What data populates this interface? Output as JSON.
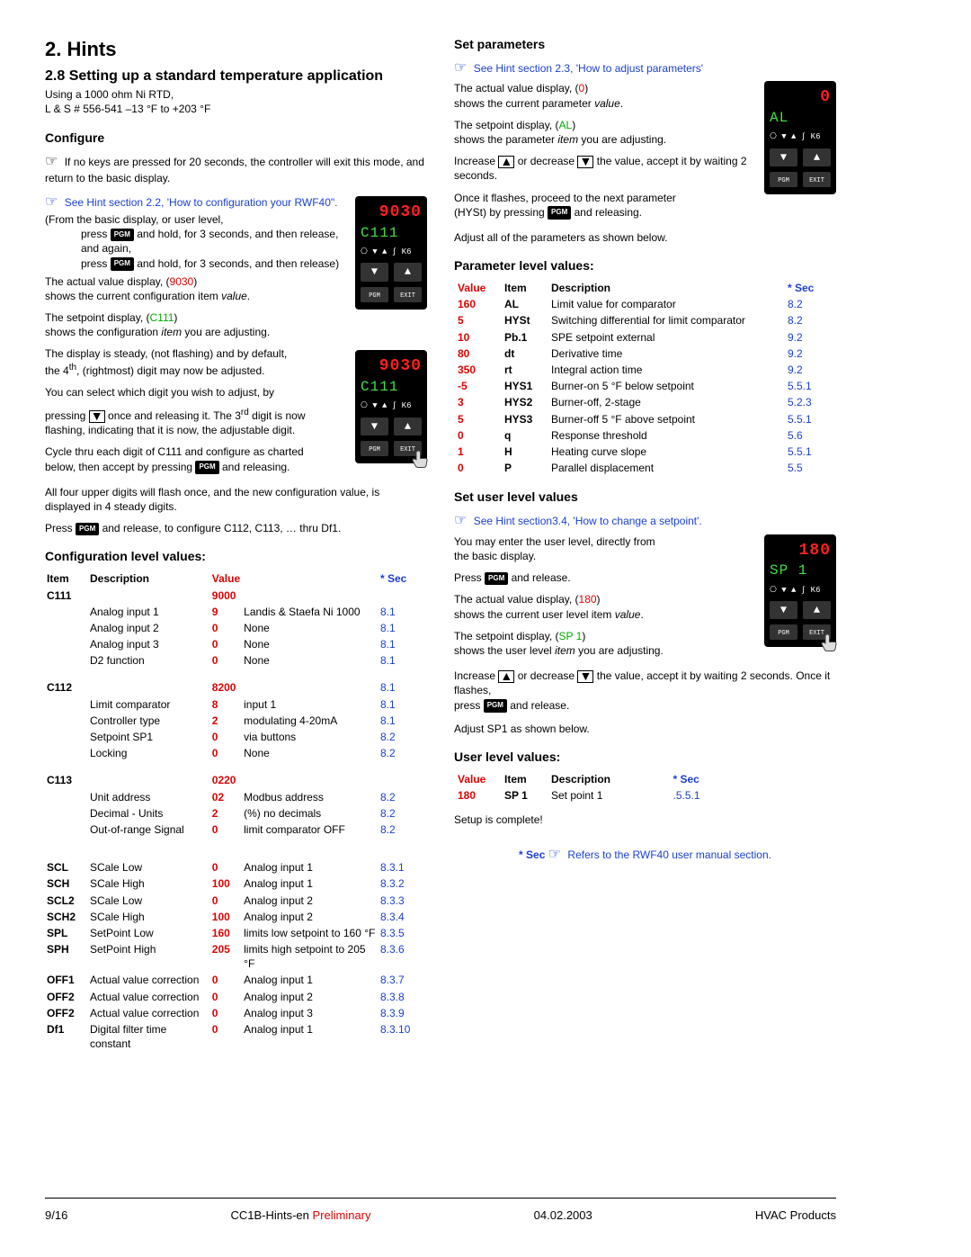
{
  "left": {
    "h1": "2. Hints",
    "h2": "2.8 Setting up a standard temperature application",
    "intro1": "Using a 1000 ohm Ni RTD,",
    "intro2": "L & S # 556-541 –13 °F to +203 °F",
    "configure": "Configure",
    "cfg_p1_a": "If no keys are pressed for 20 seconds, the controller will exit this mode, and return to the basic display.",
    "cfg_link": "See Hint section 2.2, 'How to configuration your RWF40\".",
    "cfg_p2": "(From the basic display, or user level,",
    "cfg_p3a": "press ",
    "cfg_p3b": " and hold, for 3 seconds, and then release, and again,",
    "cfg_p4a": "press ",
    "cfg_p4b": " and hold, for 3 seconds, and then release)",
    "cfg_p5a": "The actual value display, (",
    "cfg_p5_val": "9030",
    "cfg_p5b": ")",
    "cfg_p5c": "shows the current configuration item ",
    "cfg_p5d": "value",
    "cfg_p6a": "The setpoint display, (",
    "cfg_p6_val": "C111",
    "cfg_p6b": ")",
    "cfg_p6c": "shows the configuration ",
    "cfg_p6d": "item",
    "cfg_p6e": " you are adjusting.",
    "cfg_p7a": "The display is steady, (not flashing) and by default,",
    "cfg_p7b": "the 4",
    "cfg_p7c": ", (rightmost) digit may now be adjusted.",
    "cfg_p8": "You can select which digit you wish to adjust, by",
    "cfg_p9a": "pressing ",
    "cfg_p9b": " once and releasing it. The 3",
    "cfg_p9c": " digit is now flashing, indicating that it is now, the adjustable digit.",
    "cfg_p10a": "Cycle thru each digit of C111 and configure as charted",
    "cfg_p10b": "below, then accept by pressing ",
    "cfg_p10c": " and releasing.",
    "cfg_p11": "All four upper digits will flash once, and the new configuration value, is displayed in 4 steady digits.",
    "cfg_p12a": "Press ",
    "cfg_p12b": " and release, to configure C112, C113, … thru Df1.",
    "cfg_h3": "Configuration level values:",
    "config_head": {
      "item": "Item",
      "desc": "Description",
      "value": "Value",
      "sec": "* Sec"
    },
    "config_groups": [
      {
        "item": "C111",
        "group": "9000",
        "sec": "",
        "rows": [
          {
            "desc": "Analog input 1",
            "v": "9",
            "extra": "Landis & Staefa Ni 1000",
            "sec": "8.1"
          },
          {
            "desc": "Analog input 2",
            "v": "0",
            "extra": "None",
            "sec": "8.1"
          },
          {
            "desc": "Analog input 3",
            "v": "0",
            "extra": "None",
            "sec": "8.1"
          },
          {
            "desc": "D2 function",
            "v": "0",
            "extra": "None",
            "sec": "8.1"
          }
        ]
      },
      {
        "item": "C112",
        "group": "8200",
        "sec": "8.1",
        "rows": [
          {
            "desc": "Limit comparator",
            "v": "8",
            "extra": "input 1",
            "sec": "8.1"
          },
          {
            "desc": "Controller type",
            "v": "2",
            "extra": "modulating 4-20mA",
            "sec": "8.1"
          },
          {
            "desc": "Setpoint SP1",
            "v": "0",
            "extra": "via buttons",
            "sec": "8.2"
          },
          {
            "desc": "Locking",
            "v": "0",
            "extra": "None",
            "sec": "8.2"
          }
        ]
      },
      {
        "item": "C113",
        "group": "0220",
        "sec": "",
        "rows": [
          {
            "desc": "Unit address",
            "v": "02",
            "extra": "Modbus address",
            "sec": "8.2"
          },
          {
            "desc": "Decimal - Units",
            "v": "2",
            "extra": "(%) no decimals",
            "sec": "8.2"
          },
          {
            "desc": "Out-of-range Signal",
            "v": "0",
            "extra": "limit comparator OFF",
            "sec": "8.2"
          }
        ]
      }
    ],
    "config_singles": [
      {
        "item": "SCL",
        "desc": "SCale Low",
        "v": "0",
        "extra": "Analog input 1",
        "sec": "8.3.1"
      },
      {
        "item": "SCH",
        "desc": "SCale High",
        "v": "100",
        "extra": "Analog input 1",
        "sec": "8.3.2"
      },
      {
        "item": "SCL2",
        "desc": "SCale Low",
        "v": "0",
        "extra": "Analog input 2",
        "sec": "8.3.3"
      },
      {
        "item": "SCH2",
        "desc": "SCale High",
        "v": "100",
        "extra": "Analog input 2",
        "sec": "8.3.4"
      },
      {
        "item": "SPL",
        "desc": "SetPoint Low",
        "v": "160",
        "extra": "limits low setpoint to 160 °F",
        "sec": "8.3.5"
      },
      {
        "item": "SPH",
        "desc": "SetPoint High",
        "v": "205",
        "extra": "limits high setpoint to 205 °F",
        "sec": "8.3.6"
      },
      {
        "item": "OFF1",
        "desc": "Actual value correction",
        "v": "0",
        "extra": "Analog input 1",
        "sec": "8.3.7"
      },
      {
        "item": "OFF2",
        "desc": "Actual value correction",
        "v": "0",
        "extra": "Analog input 2",
        "sec": "8.3.8"
      },
      {
        "item": "OFF2",
        "desc": "Actual value correction",
        "v": "0",
        "extra": "Analog input 3",
        "sec": "8.3.9"
      },
      {
        "item": "Df1",
        "desc": "Digital filter time constant",
        "v": "0",
        "extra": "Analog input 1",
        "sec": "8.3.10"
      }
    ]
  },
  "right": {
    "sp_h3": "Set parameters",
    "sp_link": "See Hint section 2.3, 'How to adjust parameters'",
    "sp_p1a": "The actual value display, (",
    "sp_p1v": "0",
    "sp_p1b": ")",
    "sp_p1c": "shows the current parameter ",
    "sp_p1d": "value",
    "sp_p2a": "The setpoint display, (",
    "sp_p2v": "AL",
    "sp_p2b": ")",
    "sp_p2c": "shows the parameter ",
    "sp_p2d": "item",
    "sp_p2e": " you are adjusting.",
    "sp_p3a": "Increase ",
    "sp_p3b": " or decrease ",
    "sp_p3c": " the value, accept it by waiting 2 seconds.",
    "sp_p4a": "Once it flashes, proceed to the next parameter",
    "sp_p4b": "(HYSt) by pressing ",
    "sp_p4c": " and releasing.",
    "sp_p5": "Adjust all of the parameters as shown below.",
    "plv_h3": "Parameter level values:",
    "plv_head": {
      "value": "Value",
      "item": "Item",
      "desc": "Description",
      "sec": "* Sec"
    },
    "plv_rows": [
      {
        "v": "160",
        "item": "AL",
        "desc": "Limit value for comparator",
        "sec": "8.2"
      },
      {
        "v": "5",
        "item": "HYSt",
        "desc": "Switching differential for limit comparator",
        "sec": "8.2"
      },
      {
        "v": "10",
        "item": "Pb.1",
        "desc": "SPE setpoint external",
        "sec": "9.2"
      },
      {
        "v": "80",
        "item": "dt",
        "desc": "Derivative time",
        "sec": "9.2"
      },
      {
        "v": "350",
        "item": "rt",
        "desc": "Integral action time",
        "sec": "9.2"
      },
      {
        "v": "-5",
        "item": "HYS1",
        "desc": "Burner-on 5 °F below setpoint",
        "sec": "5.5.1"
      },
      {
        "v": "3",
        "item": "HYS2",
        "desc": "Burner-off, 2-stage",
        "sec": "5.2.3"
      },
      {
        "v": "5",
        "item": "HYS3",
        "desc": "Burner-off 5 °F above setpoint",
        "sec": "5.5.1"
      },
      {
        "v": "0",
        "item": "q",
        "desc": "Response threshold",
        "sec": "5.6"
      },
      {
        "v": "1",
        "item": "H",
        "desc": "Heating curve slope",
        "sec": "5.5.1"
      },
      {
        "v": "0",
        "item": "P",
        "desc": "Parallel displacement",
        "sec": "5.5"
      }
    ],
    "sul_h3": "Set user level values",
    "sul_link": "See Hint section3.4, 'How to change a setpoint'.",
    "sul_p1a": "You may enter the user level, directly from",
    "sul_p1b": "the basic display.",
    "sul_p2a": "Press ",
    "sul_p2b": " and release.",
    "sul_p3a": "The actual value display, (",
    "sul_p3v": "180",
    "sul_p3b": ")",
    "sul_p3c": "shows the current user level item ",
    "sul_p3d": "value",
    "sul_p4a": "The setpoint display, (",
    "sul_p4v": "SP 1",
    "sul_p4b": ")",
    "sul_p4c": "shows the user level ",
    "sul_p4d": "item",
    "sul_p4e": " you are adjusting.",
    "sul_p5a": "Increase ",
    "sul_p5b": " or decrease ",
    "sul_p5c": " the value, accept it by waiting 2 seconds. Once it flashes,",
    "sul_p5d": "press ",
    "sul_p5e": " and release.",
    "sul_p6": "Adjust SP1 as shown below.",
    "ulv_h3": "User level values:",
    "ulv_head": {
      "value": "Value",
      "item": "Item",
      "desc": "Description",
      "sec": "* Sec"
    },
    "ulv_rows": [
      {
        "v": "180",
        "item": "SP 1",
        "desc": "Set point 1",
        "sec": ".5.5.1"
      }
    ],
    "done": "Setup is complete!",
    "note_a": "* Sec ",
    "note_b": " Refers to the RWF40 user manual section."
  },
  "controllers": {
    "c1": {
      "red": "9030",
      "green": "C111"
    },
    "c2": {
      "red": "9030",
      "green": "C111"
    },
    "c3": {
      "red": "0",
      "green": "AL"
    },
    "c4": {
      "red": "180",
      "green": "SP 1"
    }
  },
  "footer": {
    "left": "9/16",
    "center_a": "CC1B-Hints-en ",
    "center_b": "Preliminary",
    "date": "04.02.2003",
    "right": "HVAC Products"
  },
  "icons": {
    "pgm": "PGM",
    "ctrl_icons": "⎔ ▼ ▲ ∫ K6"
  }
}
